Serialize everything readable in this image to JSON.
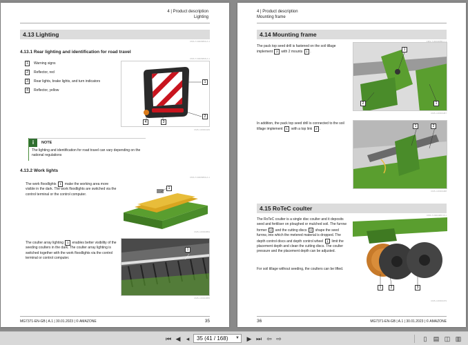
{
  "left_page": {
    "header": {
      "line1": "4 | Product description",
      "line2": "Lighting"
    },
    "section": {
      "title": "4.13  Lighting",
      "id": "CMS-T-00006899-A.1"
    },
    "sub1": {
      "title": "4.13.1  Rear lighting and identification for road travel",
      "id": "CMS-T-00006898-A.1",
      "legend": [
        {
          "num": "1",
          "text": "Warning signs"
        },
        {
          "num": "2",
          "text": "Reflector, red"
        },
        {
          "num": "3",
          "text": "Rear lights, brake lights, and turn indicators"
        },
        {
          "num": "4",
          "text": "Reflector, yellow"
        }
      ],
      "figure_id": "CMS-I-00004449",
      "callouts": [
        "1",
        "2",
        "3",
        "4"
      ]
    },
    "note": {
      "title": "NOTE",
      "text": "The lighting and identification for road travel can vary depending on the national regulations"
    },
    "sub2": {
      "title": "4.13.2  Work lights",
      "id": "CMS-T-00006899-A.1",
      "para1_a": "The work floodlights",
      "para1_num": "1",
      "para1_b": "make the working area more visible in the dark. The work floodlights are switched via the control terminal or the control computer.",
      "fig1_id": "CMS-I-00004854",
      "fig1_callout": "1",
      "para2_a": "The coulter array lighting",
      "para2_num": "1",
      "para2_b": "enables better visibility of the seeding coulters in the dark. The coulter array lighting is switched together with the work floodlights via the control terminal or control computer.",
      "fig2_id": "CMS-I-00004855",
      "fig2_callout": "1"
    },
    "footer": {
      "doc": "MG7371-EN-GB | A.1 | 30.01.2023 | © AMAZONE",
      "page": "35"
    }
  },
  "right_page": {
    "header": {
      "line1": "4 | Product description",
      "line2": "Mounting frame"
    },
    "section1": {
      "title": "4.14  Mounting frame",
      "id": "CMS-T-00004886-C.1",
      "para1_a": "The pack top seed drill is fastened on the soil tillage implement",
      "para1_n1": "2",
      "para1_b": "with 2 mounts",
      "para1_n2": "1",
      "para1_c": ".",
      "fig1_id": "CMS-I-00003487",
      "fig1_callouts": [
        "1",
        "2",
        "1"
      ],
      "para2_a": "In addition, the pack top seed drill is connected to the soil tillage implement",
      "para2_n1": "1",
      "para2_b": "with a top link",
      "para2_n2": "2",
      "para2_c": ".",
      "fig2_id": "CMS-I-00003488",
      "fig2_callouts": [
        "1",
        "2"
      ]
    },
    "section2": {
      "title": "4.15  RoTeC coulter",
      "id": "CMS-T-00004887-B.1",
      "para1_a": "The RoTeC coulter is a single disc coulter and it deposits seed and fertiliser on ploughed or mulched soil. The furrow former",
      "para1_n1": "2",
      "para1_b": "and the cutting discs",
      "para1_n2": "3",
      "para1_c": "shape the seed furrow, into which the metered material is dropped. The depth control discs and depth control wheel",
      "para1_n3": "1",
      "para1_d": "limit the placement depth and clean the cutting discs. The coulter pressure and the placement depth can be adjusted.",
      "para2": "For soil tillage without seeding, the coulters can be lifted.",
      "fig_id": "CMS-I-00003479",
      "fig_callouts": [
        "1",
        "2",
        "3"
      ]
    },
    "footer": {
      "doc": "MG7371-EN-GB | A.1 | 30.01.2023 | © AMAZONE",
      "page": "36"
    }
  },
  "toolbar": {
    "page_field": "35 (41 / 168)",
    "icons": [
      "first-page-icon",
      "prev-page-icon",
      "next-page-icon",
      "last-page-icon",
      "back-icon",
      "forward-icon",
      "single-page-icon",
      "continuous-icon",
      "two-page-icon",
      "two-page-continuous-icon"
    ]
  },
  "colors": {
    "green": "#5a9e2f",
    "dark_green": "#2f6f2f",
    "red": "#c8141e",
    "orange": "#d97a1a",
    "toolbar": "#d8d8d8",
    "background": "#8a8a8a"
  }
}
